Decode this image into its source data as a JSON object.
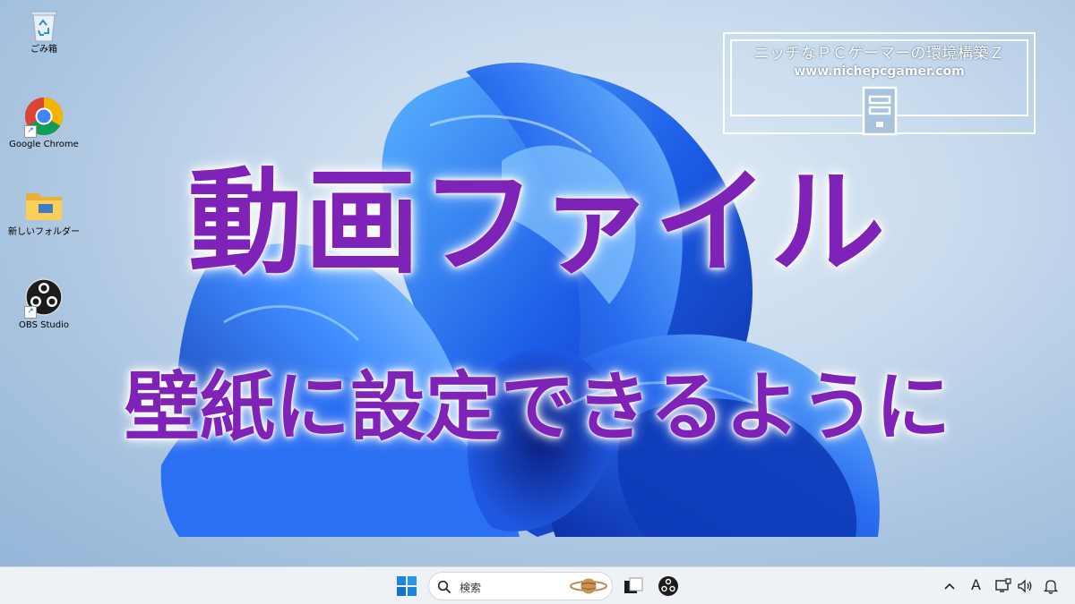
{
  "desktop": {
    "icons": [
      {
        "name": "recycle-bin",
        "label": "ごみ箱"
      },
      {
        "name": "google-chrome",
        "label": "Google Chrome"
      },
      {
        "name": "new-folder",
        "label": "新しいフォルダー"
      },
      {
        "name": "obs-studio",
        "label": "OBS Studio"
      }
    ]
  },
  "overlay": {
    "title": "動画ファイル",
    "subtitle": "壁紙に設定できるように"
  },
  "brand": {
    "title": "ニッチなＰＣゲーマーの環境構築Ｚ",
    "url": "www.nichepcgamer.com"
  },
  "taskbar": {
    "search_placeholder": "検索",
    "ime_indicator": "A",
    "items": [
      "start-icon",
      "search",
      "task-view-icon",
      "obs-studio-icon"
    ],
    "tray": [
      "chevron-up-icon",
      "ime-indicator",
      "network-icon",
      "volume-icon",
      "notification-bell-icon"
    ]
  },
  "colors": {
    "headline": "#7f22b8",
    "taskbar": "#eef1f6",
    "bloom_dark": "#0a2fa8",
    "bloom_light": "#4aa3ff"
  }
}
